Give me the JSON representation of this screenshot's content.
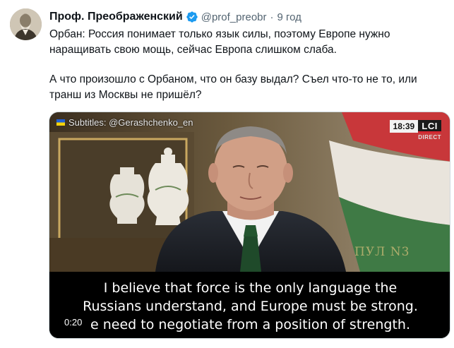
{
  "tweet": {
    "author": {
      "display_name": "Проф. Преображенский",
      "handle": "@prof_preobr",
      "verified": true
    },
    "separator": "·",
    "time": "9 год",
    "paragraphs": [
      "Орбан: Россия понимает только язык силы, поэтому Европе нужно наращивать свою мощь, сейчас Европа слишком слаба.",
      "А что произошло с Орбаном, что он базу выдал? Съел что-то не то, или транш из Москвы не пришёл?"
    ]
  },
  "media": {
    "subtitle_tag": "Subtitles: @Gerashchenko_en",
    "broadcast_time": "18:39",
    "channel_logo": "LCI",
    "channel_status": "DIRECT",
    "watermark": "ПУЛ N3",
    "caption_lines": [
      "I believe that force is the only language the",
      "Russians understand, and Europe must be strong.",
      "e need to negotiate from a position of strength."
    ],
    "video_timestamp": "0:20"
  },
  "colors": {
    "text_primary": "#0f1419",
    "text_secondary": "#536471",
    "verified_blue": "#1d9bf0",
    "border": "#cfd9de"
  },
  "icons": {
    "verified": "verified-badge-icon",
    "subtitle_flag": "ukraine-flag-icon"
  }
}
